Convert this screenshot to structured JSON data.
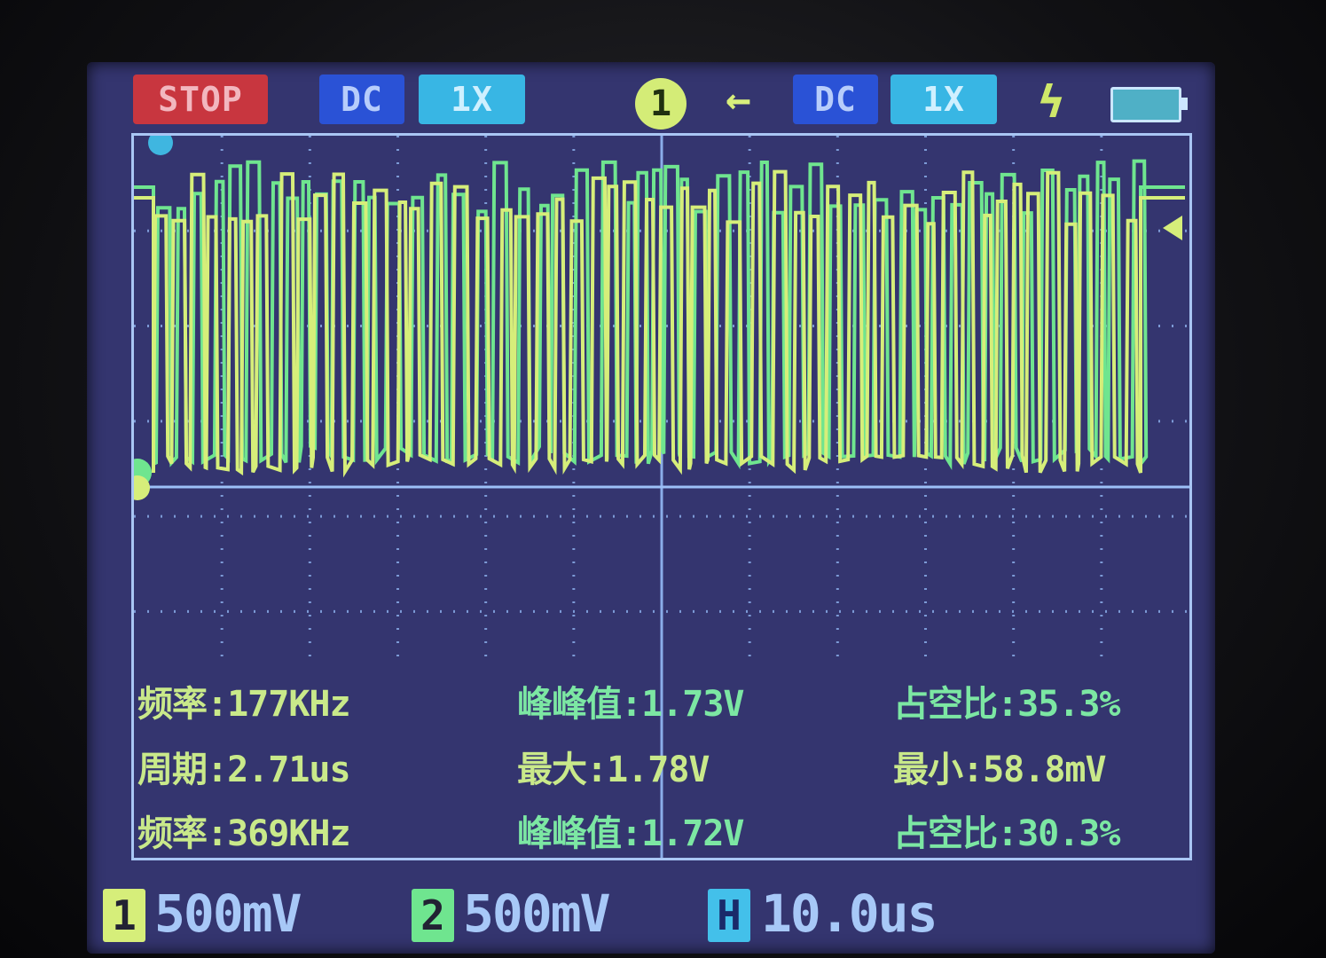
{
  "status": {
    "run_state": "STOP"
  },
  "channel1": {
    "coupling": "DC",
    "probe": "1X",
    "volts_per_div": "500mV",
    "badge": "1"
  },
  "channel2": {
    "coupling": "DC",
    "probe": "1X",
    "volts_per_div": "500mV",
    "badge": "2"
  },
  "trigger": {
    "channel": "1",
    "arrow": "←",
    "edge_icon": "lightning-icon"
  },
  "timebase": {
    "badge": "H",
    "time_per_div": "10.0us"
  },
  "battery": {
    "icon": "battery-icon"
  },
  "measurements": {
    "row1": [
      {
        "label": "频率:",
        "value": "177KHz"
      },
      {
        "label": "峰峰值:",
        "value": "1.73V"
      },
      {
        "label": "占空比:",
        "value": "35.3%"
      }
    ],
    "row2": [
      {
        "label": "周期:",
        "value": "2.71us"
      },
      {
        "label": "最大:",
        "value": "1.78V"
      },
      {
        "label": "最小:",
        "value": "58.8mV"
      }
    ],
    "row3": [
      {
        "label": "频率:",
        "value": "369KHz"
      },
      {
        "label": "峰峰值:",
        "value": "1.72V"
      },
      {
        "label": "占空比:",
        "value": "30.3%"
      }
    ]
  },
  "colors": {
    "ch1": "#d6ee7a",
    "ch2": "#6fe58f",
    "grid": "#8fb4f0",
    "screen_bg": "#34356f",
    "stop": "#c8363f"
  }
}
